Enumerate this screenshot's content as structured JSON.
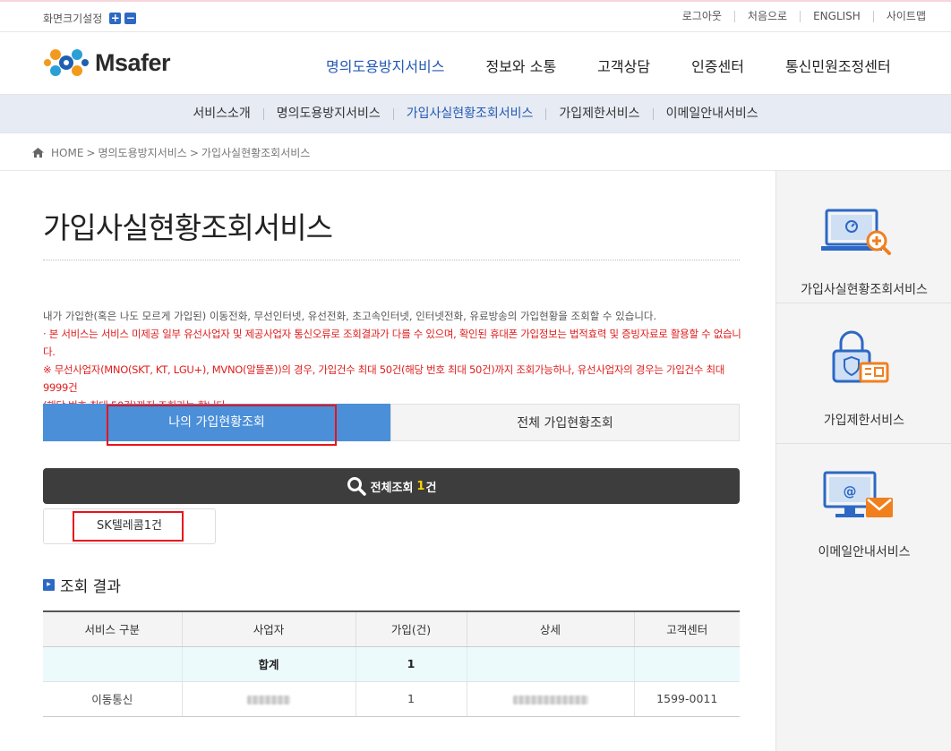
{
  "util": {
    "screen_setting": "화면크기설정",
    "zoom_in": "+",
    "zoom_out": "−",
    "links": [
      "로그아웃",
      "처음으로",
      "ENGLISH",
      "사이트맵"
    ]
  },
  "header": {
    "logo_text": "Msafer",
    "gnb": [
      "명의도용방지서비스",
      "정보와 소통",
      "고객상담",
      "인증센터",
      "통신민원조정센터"
    ],
    "gnb_active": 0
  },
  "subnav": {
    "items": [
      "서비스소개",
      "명의도용방지서비스",
      "가입사실현황조회서비스",
      "가입제한서비스",
      "이메일안내서비스"
    ],
    "active": 2
  },
  "breadcrumb": {
    "home": "HOME",
    "items": [
      "명의도용방지서비스",
      "가입사실현황조회서비스"
    ]
  },
  "main": {
    "title": "가입사실현황조회서비스",
    "desc_line1": "내가 가입한(혹은 나도 모르게 가입된) 이동전화, 무선인터넷, 유선전화, 초고속인터넷, 인터넷전화, 유료방송의 가입현황을 조회할 수 있습니다.",
    "desc_line2": "· 본 서비스는 서비스 미제공 일부 유선사업자 및 제공사업자 통신오류로 조회결과가 다를 수 있으며, 확인된 휴대폰 가입정보는 법적효력 및 증빙자료로 활용할 수 없습니다.",
    "desc_line3": "※ 무선사업자(MNO(SKT, KT, LGU+), MVNO(알뜰폰))의 경우, 가입건수 최대 50건(해당 번호 최대 50건)까지 조회가능하나, 유선사업자의 경우는 가입건수 최대 9999건",
    "desc_line4": "(해당 번호 최대 50건)까지 조회가능 합니다.",
    "tabs": [
      "나의 가입현황조회",
      "전체 가입현황조회"
    ],
    "search_label": "전체조회",
    "search_count": "1",
    "search_unit": "건",
    "carrier_button": "SK텔레콤1건",
    "result_title": "조회 결과",
    "table": {
      "headers": [
        "서비스 구분",
        "사업자",
        "가입(건)",
        "상세",
        "고객센터"
      ],
      "sum_row": [
        "",
        "합계",
        "1",
        "",
        ""
      ],
      "rows": [
        [
          "이동통신",
          "",
          "1",
          "",
          "1599-0011"
        ]
      ]
    }
  },
  "side": {
    "items": [
      "가입사실현황조회서비스",
      "가입제한서비스",
      "이메일안내서비스"
    ]
  },
  "colors": {
    "brand_blue": "#2459b4",
    "tab_active": "#4a8fd8",
    "alert_red": "#e01d1d",
    "icon_orange": "#f07f1e"
  },
  "icons": [
    "plus-icon",
    "minus-icon",
    "home-icon",
    "search-icon",
    "section-arrow-icon",
    "computer-zoom-icon",
    "lock-card-icon",
    "computer-mail-icon"
  ]
}
